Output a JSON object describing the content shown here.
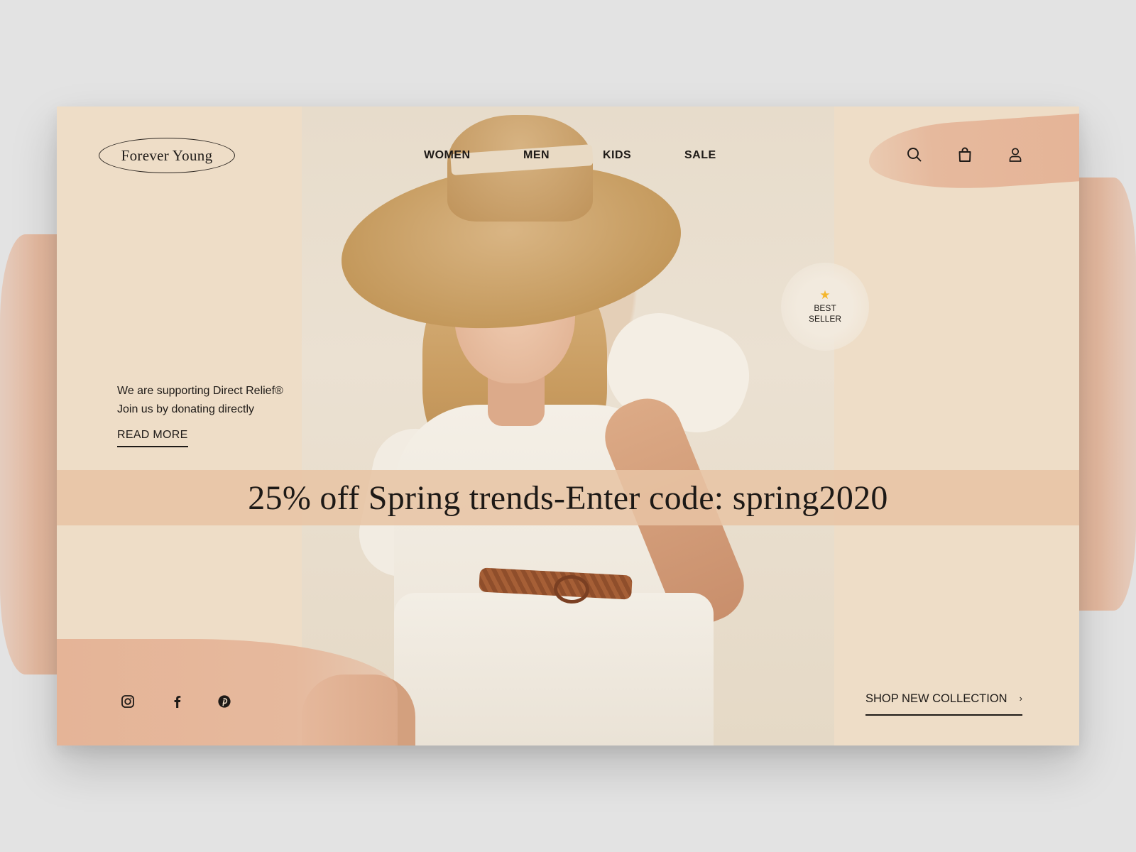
{
  "brand": {
    "logo_text": "Forever Young"
  },
  "nav": {
    "items": [
      {
        "label": "WOMEN"
      },
      {
        "label": "MEN"
      },
      {
        "label": "KIDS"
      },
      {
        "label": "SALE"
      }
    ]
  },
  "header_icons": [
    {
      "name": "search-icon"
    },
    {
      "name": "shopping-bag-icon"
    },
    {
      "name": "user-icon"
    }
  ],
  "badge": {
    "icon": "star-icon",
    "line1": "BEST",
    "line2": "SELLER",
    "star_color": "#f4b62c"
  },
  "support": {
    "line1": "We are supporting Direct Relief®",
    "line2": "Join us by donating directly",
    "read_more": "READ MORE"
  },
  "promo": {
    "text": "25% off Spring trends-Enter code: spring2020"
  },
  "social": [
    {
      "name": "instagram-icon"
    },
    {
      "name": "facebook-icon"
    },
    {
      "name": "pinterest-icon"
    }
  ],
  "cta": {
    "label": "SHOP NEW COLLECTION",
    "chevron": "›"
  },
  "colors": {
    "background": "#e3e3e3",
    "card": "#eeddc7",
    "accent_brush": "#e5b497",
    "promo_band": "#e8c4a4",
    "text": "#1e1a17"
  }
}
